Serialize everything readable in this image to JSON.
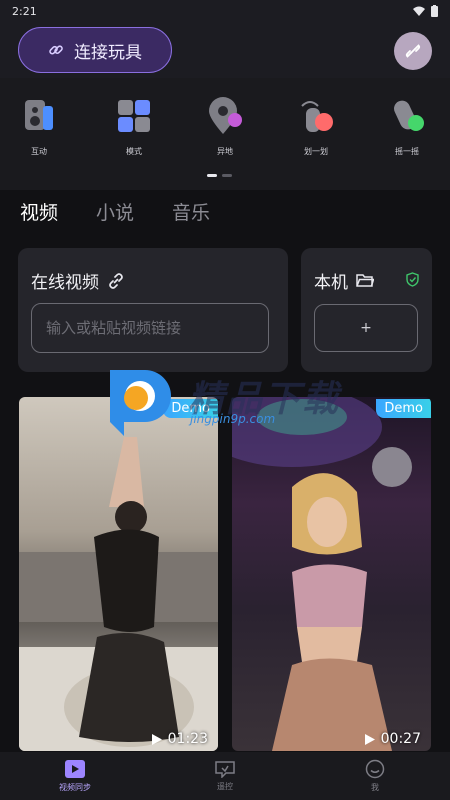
{
  "status": {
    "time": "2:21"
  },
  "header": {
    "connect_label": "连接玩具"
  },
  "modes": [
    {
      "label": "互动",
      "icon": "speaker-icon"
    },
    {
      "label": "模式",
      "icon": "grid-icon"
    },
    {
      "label": "异地",
      "icon": "location-icon"
    },
    {
      "label": "划一划",
      "icon": "swipe-icon"
    },
    {
      "label": "摇一摇",
      "icon": "shake-icon"
    }
  ],
  "tabs": [
    "视频",
    "小说",
    "音乐"
  ],
  "online": {
    "title": "在线视频",
    "placeholder": "输入或粘贴视频链接"
  },
  "local": {
    "title": "本机",
    "add": "+"
  },
  "videos": [
    {
      "badge": "Demo",
      "duration": "01:23"
    },
    {
      "badge": "Demo",
      "duration": "00:27"
    }
  ],
  "watermark": {
    "title": "精品下载",
    "site": "jingpin9p.com"
  },
  "nav": [
    {
      "label": "视频同步",
      "icon": "video-sync-icon"
    },
    {
      "label": "遥控",
      "icon": "remote-icon"
    },
    {
      "label": "我",
      "icon": "profile-icon"
    }
  ],
  "colors": {
    "accent": "#8a6fe0",
    "demo_badge": "#3aa6ff",
    "shield": "#3fc56b"
  }
}
